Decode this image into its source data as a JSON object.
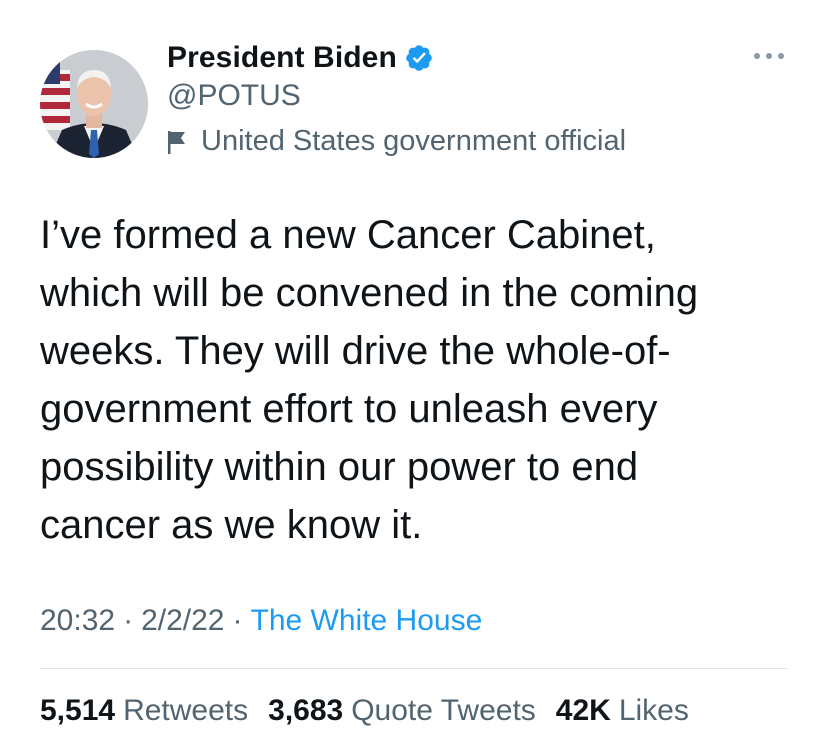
{
  "header": {
    "display_name": "President Biden",
    "handle": "@POTUS",
    "account_label": "United States government official",
    "verified_icon": "verified-badge-icon",
    "label_icon": "flag-icon",
    "more_icon": "more-options-icon"
  },
  "tweet": {
    "text": "I’ve formed a new Cancer Cabinet,\nwhich will be convened in the coming\nweeks. They will drive the whole-of-\ngovernment effort to unleash every\npossibility within our power to end\ncancer as we know it."
  },
  "meta": {
    "time": "20:32",
    "date": "2/2/22",
    "separator": "·",
    "source": "The White House"
  },
  "stats": {
    "retweets_count": "5,514",
    "retweets_label": "Retweets",
    "quotes_count": "3,683",
    "quotes_label": "Quote Tweets",
    "likes_count": "42K",
    "likes_label": "Likes"
  },
  "colors": {
    "accent": "#1d9bf0",
    "secondary_text": "#536471",
    "primary_text": "#0f1419"
  }
}
